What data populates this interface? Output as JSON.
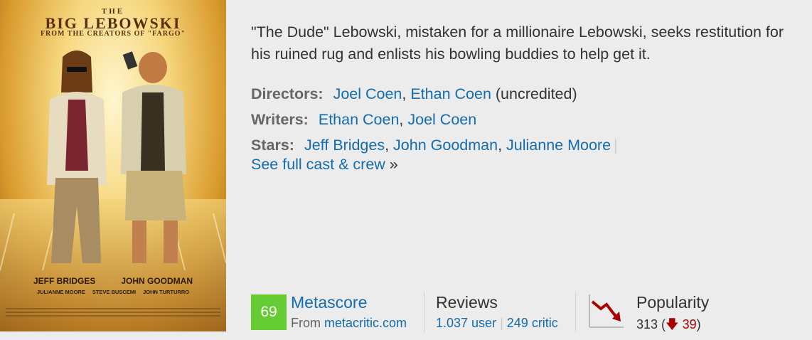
{
  "poster": {
    "title_small": "THE",
    "title": "BIG LEBOWSKI",
    "tagline": "FROM THE CREATORS OF \"FARGO\"",
    "lead_cast": [
      "JEFF BRIDGES",
      "JOHN GOODMAN"
    ],
    "supporting_cast": [
      "JULIANNE MOORE",
      "STEVE BUSCEMI",
      "JOHN TURTURRO"
    ]
  },
  "summary": "\"The Dude\" Lebowski, mistaken for a millionaire Lebowski, seeks restitution for his ruined rug and enlists his bowling buddies to help get it.",
  "directors": {
    "label": "Directors:",
    "people": [
      "Joel Coen",
      "Ethan Coen"
    ],
    "note": "(uncredited)"
  },
  "writers": {
    "label": "Writers:",
    "people": [
      "Ethan Coen",
      "Joel Coen"
    ]
  },
  "stars": {
    "label": "Stars:",
    "people": [
      "Jeff Bridges",
      "John Goodman",
      "Julianne Moore"
    ],
    "separator": "|"
  },
  "full_cast": {
    "label": "See full cast & crew",
    "arrow": "»"
  },
  "metascore": {
    "score": "69",
    "title": "Metascore",
    "from_label": "From",
    "source": "metacritic.com",
    "color": "#66cc33"
  },
  "reviews": {
    "title": "Reviews",
    "user": "1.037 user",
    "separator": "|",
    "critic": "249 critic"
  },
  "popularity": {
    "title": "Popularity",
    "rank": "313",
    "change": "39",
    "trend": "down",
    "trend_color": "#a70000",
    "icon": "popularity-down-chart-icon"
  }
}
